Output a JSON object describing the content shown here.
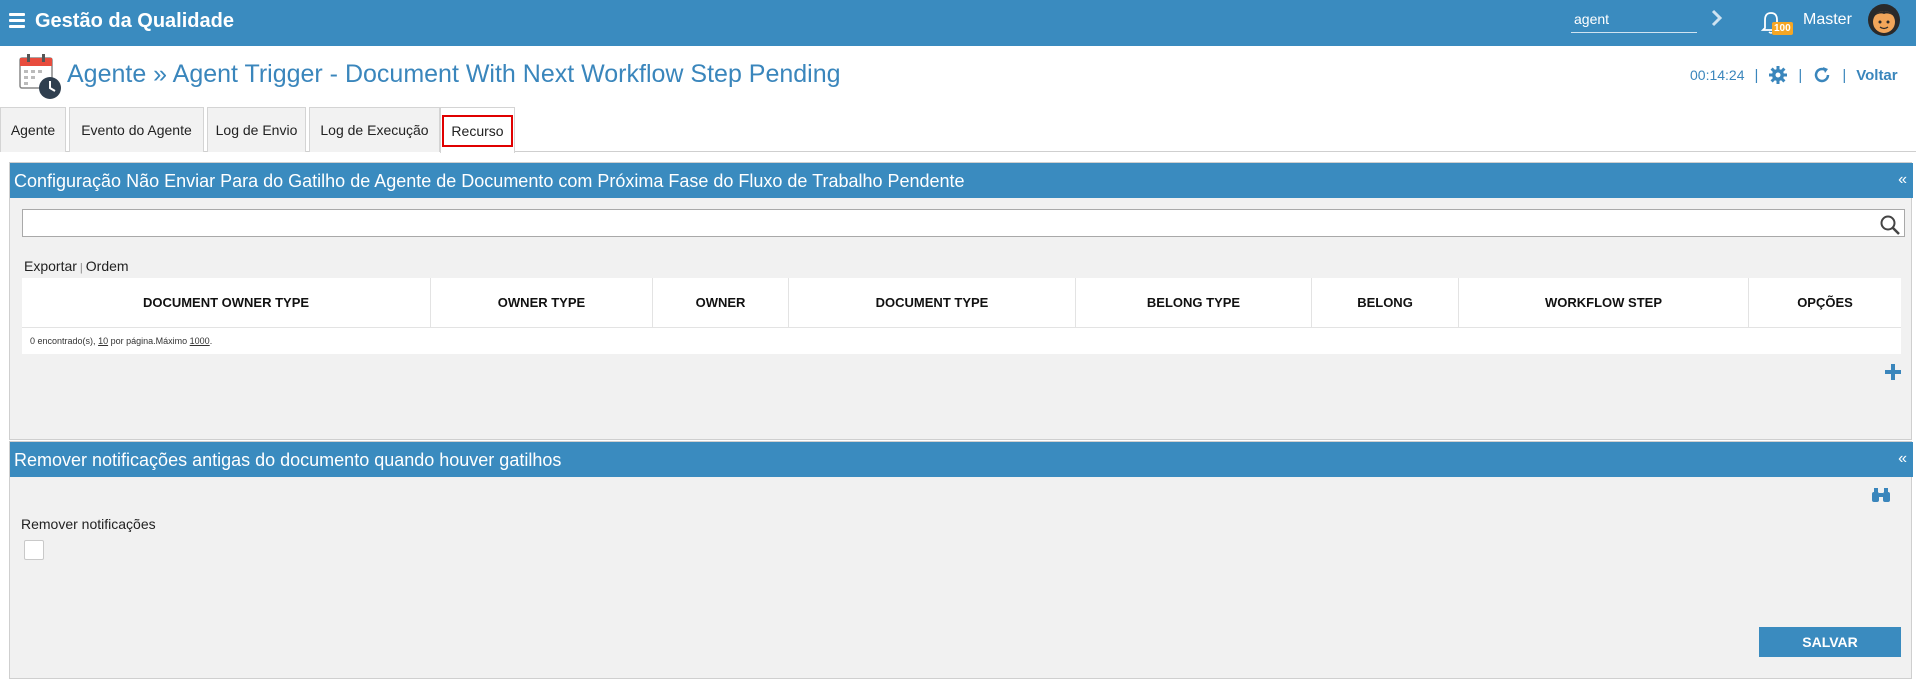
{
  "header": {
    "app_title": "Gestão da Qualidade",
    "search_value": "agent",
    "notification_count": "100",
    "user_name": "Master"
  },
  "page": {
    "title": "Agente » Agent Trigger - Document With Next Workflow Step Pending",
    "timer": "00:14:24",
    "back_label": "Voltar"
  },
  "tabs": [
    {
      "label": "Agente"
    },
    {
      "label": "Evento do Agente"
    },
    {
      "label": "Log de Envio"
    },
    {
      "label": "Log de Execução"
    },
    {
      "label": "Recurso"
    }
  ],
  "panel1": {
    "title": "Configuração Não Enviar Para do Gatilho de Agente de Documento com Próxima Fase do Fluxo de Trabalho Pendente",
    "collapse": "«",
    "search_value": "",
    "export_label": "Exportar",
    "order_label": "Ordem",
    "columns": [
      "DOCUMENT OWNER TYPE",
      "OWNER TYPE",
      "OWNER",
      "DOCUMENT TYPE",
      "BELONG TYPE",
      "BELONG",
      "WORKFLOW STEP",
      "OPÇÕES"
    ],
    "rows": [],
    "footer": {
      "found": "0 encontrado(s),",
      "per_page": "10",
      "per_page_text": "por página.Máximo",
      "max": "1000",
      "end": "."
    }
  },
  "panel2": {
    "title": "Remover notificações antigas do documento quando houver gatilhos",
    "collapse": "«",
    "field_label": "Remover notificações",
    "checked": false,
    "save_label": "SALVAR"
  },
  "colors": {
    "primary": "#3a8bbf",
    "title_text": "#3a86bc",
    "badge": "#f5a623",
    "active_tab_outline": "#e00000"
  }
}
